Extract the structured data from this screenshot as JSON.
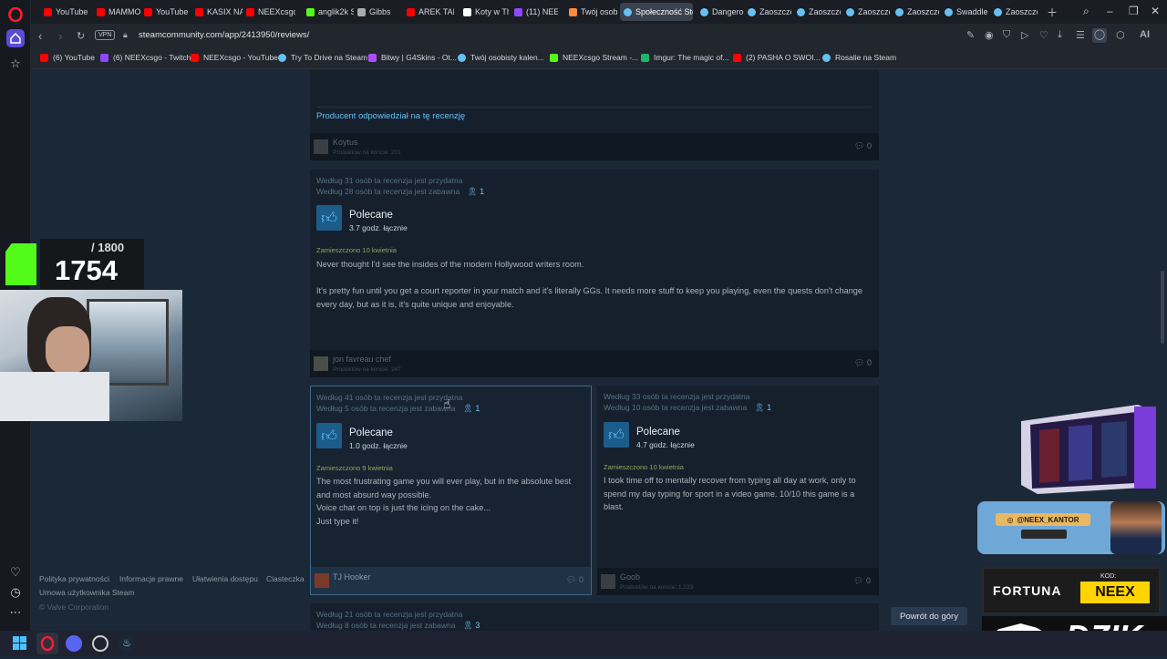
{
  "browser": {
    "tabs": [
      {
        "label": "YouTube",
        "color": "#ff0000"
      },
      {
        "label": "MAMMON",
        "color": "#ff0000"
      },
      {
        "label": "YouTube",
        "color": "#ff0000"
      },
      {
        "label": "KASIX NA",
        "color": "#ff0000"
      },
      {
        "label": "NEEXcsgo",
        "color": "#ff0000"
      },
      {
        "label": "anglik2k S",
        "color": "#53fc18"
      },
      {
        "label": "Gibbs",
        "color": "#aaaaaa"
      },
      {
        "label": "AREK TAN",
        "color": "#ff0000"
      },
      {
        "label": "Koty w Th",
        "color": "#ffffff"
      },
      {
        "label": "(11) NEEX",
        "color": "#9146ff"
      },
      {
        "label": "Twój osob",
        "color": "#ff8a3d"
      },
      {
        "label": "Społeczność Stea",
        "color": "#66c0f4"
      },
      {
        "label": "Dangerou",
        "color": "#66c0f4"
      },
      {
        "label": "Zaoszczę",
        "color": "#66c0f4"
      },
      {
        "label": "Zaoszczę",
        "color": "#66c0f4"
      },
      {
        "label": "Zaoszczę",
        "color": "#66c0f4"
      },
      {
        "label": "Zaoszczę",
        "color": "#66c0f4"
      },
      {
        "label": "Swaddle",
        "color": "#66c0f4"
      },
      {
        "label": "Zaoszczę",
        "color": "#66c0f4"
      }
    ],
    "url": "steamcommunity.com/app/2413950/reviews/",
    "vpn_label": "VPN",
    "ai_label": "AI",
    "bookmarks": [
      {
        "label": "(6) YouTube",
        "color": "#ff0000"
      },
      {
        "label": "(6) NEEXcsgo - Twitch",
        "color": "#9146ff"
      },
      {
        "label": "NEEXcsgo - YouTube",
        "color": "#ff0000"
      },
      {
        "label": "Try To Drive na Steam",
        "color": "#66c0f4"
      },
      {
        "label": "Bitwy | G4Skins - Ot...",
        "color": "#b04cff"
      },
      {
        "label": "Twój osobisty kalen...",
        "color": "#66c0f4"
      },
      {
        "label": "NEEXcsgo Stream -...",
        "color": "#53fc18"
      },
      {
        "label": "Imgur: The magic of...",
        "color": "#1bb76e"
      },
      {
        "label": "(2) PASHA O SWOI...",
        "color": "#ff0000"
      },
      {
        "label": "Rosalie na Steam",
        "color": "#66c0f4"
      }
    ]
  },
  "reviews": {
    "developer_reply": "Producent odpowiedział na tę recenzję",
    "r0": {
      "author": "Koytus",
      "sub": "Produktów na koncie: 201",
      "comments": "0"
    },
    "r1": {
      "helpful": "Według 31 osób ta recenzja jest przydatna",
      "funny": "Według 28 osób ta recenzja jest zabawna",
      "awards": "1",
      "verdict": "Polecane",
      "hours": "3.7 godz. łącznie",
      "posted": "Zamieszczono 10 kwietnia",
      "p1": "Never thought I'd see the insides of the modern Hollywood writers room.",
      "p2": "It's pretty fun until you get a court reporter in your match and it's literally GGs. It needs more stuff to keep you playing, even the quests don't change every day, but as it is, it's quite unique and enjoyable.",
      "author": "jon favreau chef",
      "sub": "Produktów na koncie: 247",
      "comments": "0"
    },
    "r2": {
      "helpful": "Według 41 osób ta recenzja jest przydatna",
      "funny": "Według 5 osób ta recenzja jest zabawna",
      "awards": "1",
      "verdict": "Polecane",
      "hours": "1.0 godz. łącznie",
      "posted": "Zamieszczono 9 kwietnia",
      "p1": "The most frustrating game you will ever play, but in the absolute best and most absurd way possible.",
      "p2": "Voice chat on top is just the icing on the cake...",
      "p3": "Just type it!",
      "author": "TJ Hooker",
      "comments": "0"
    },
    "r3": {
      "helpful": "Według 33 osób ta recenzja jest przydatna",
      "funny": "Według 10 osób ta recenzja jest zabawna",
      "awards": "1",
      "verdict": "Polecane",
      "hours": "4.7 godz. łącznie",
      "posted": "Zamieszczono 10 kwietnia",
      "p1": "I took time off to mentally recover from typing all day at work, only to spend my day typing for sport in a video game. 10/10 this game is a blast.",
      "author": "Goob",
      "sub": "Produktów na koncie: 1,223",
      "comments": "0"
    },
    "r4": {
      "helpful": "Według 21 osób ta recenzja jest przydatna",
      "funny": "Według 8 osób ta recenzja jest zabawna",
      "awards": "3"
    }
  },
  "footer": {
    "privacy": "Polityka prywatności",
    "legal": "Informacje prawne",
    "accessibility": "Ułatwienia dostępu",
    "cookies": "Ciasteczka",
    "agreement": "Umowa użytkownika Steam",
    "copyright": "© Valve Corporation"
  },
  "back_to_top": "Powrót do góry",
  "overlay": {
    "counter_total": "/ 1800",
    "counter_value": "1754",
    "handle": "@NEEX_KANTOR",
    "fortuna_brand": "FORTUNA",
    "fortuna_code_label": "KOD:",
    "fortuna_code": "NEEX",
    "dzik_brand": "DZIK"
  }
}
